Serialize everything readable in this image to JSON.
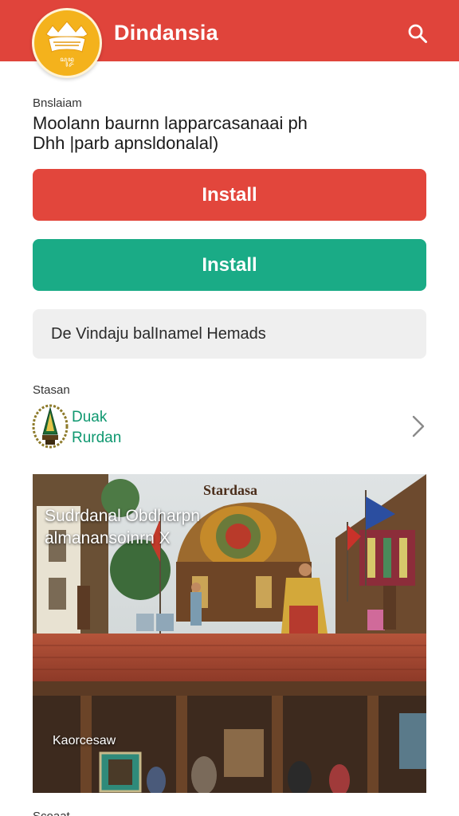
{
  "header": {
    "app_title": "Dindansia",
    "logo_text": "ꦱꦸꦤ꧀ꦢ",
    "search_icon": "search-icon",
    "color": "#e0443b"
  },
  "description": {
    "label": "Bnslaiam",
    "line1": "Moolann baurnn lapparcasanaai ph",
    "line2": "Dhh |parb apnsldonalal)"
  },
  "actions": {
    "install_primary": "Install",
    "install_secondary": "Install",
    "info_text": "De Vindaju balInamel Hemads",
    "primary_color": "#e2463c",
    "secondary_color": "#1aab86"
  },
  "source": {
    "label": "Stasan",
    "name_line1": "Duak",
    "name_line2": "Rurdan",
    "emblem_icon": "wayang-emblem-icon",
    "chevron_icon": "chevron-right-icon"
  },
  "photo": {
    "sign": "Stardasa",
    "overlay_line1": "Sudrdanal Obdharpn",
    "overlay_line2": "almanansoinrn X",
    "caption": "Kaorcesaw"
  },
  "footer": {
    "label": "Scoaat"
  }
}
